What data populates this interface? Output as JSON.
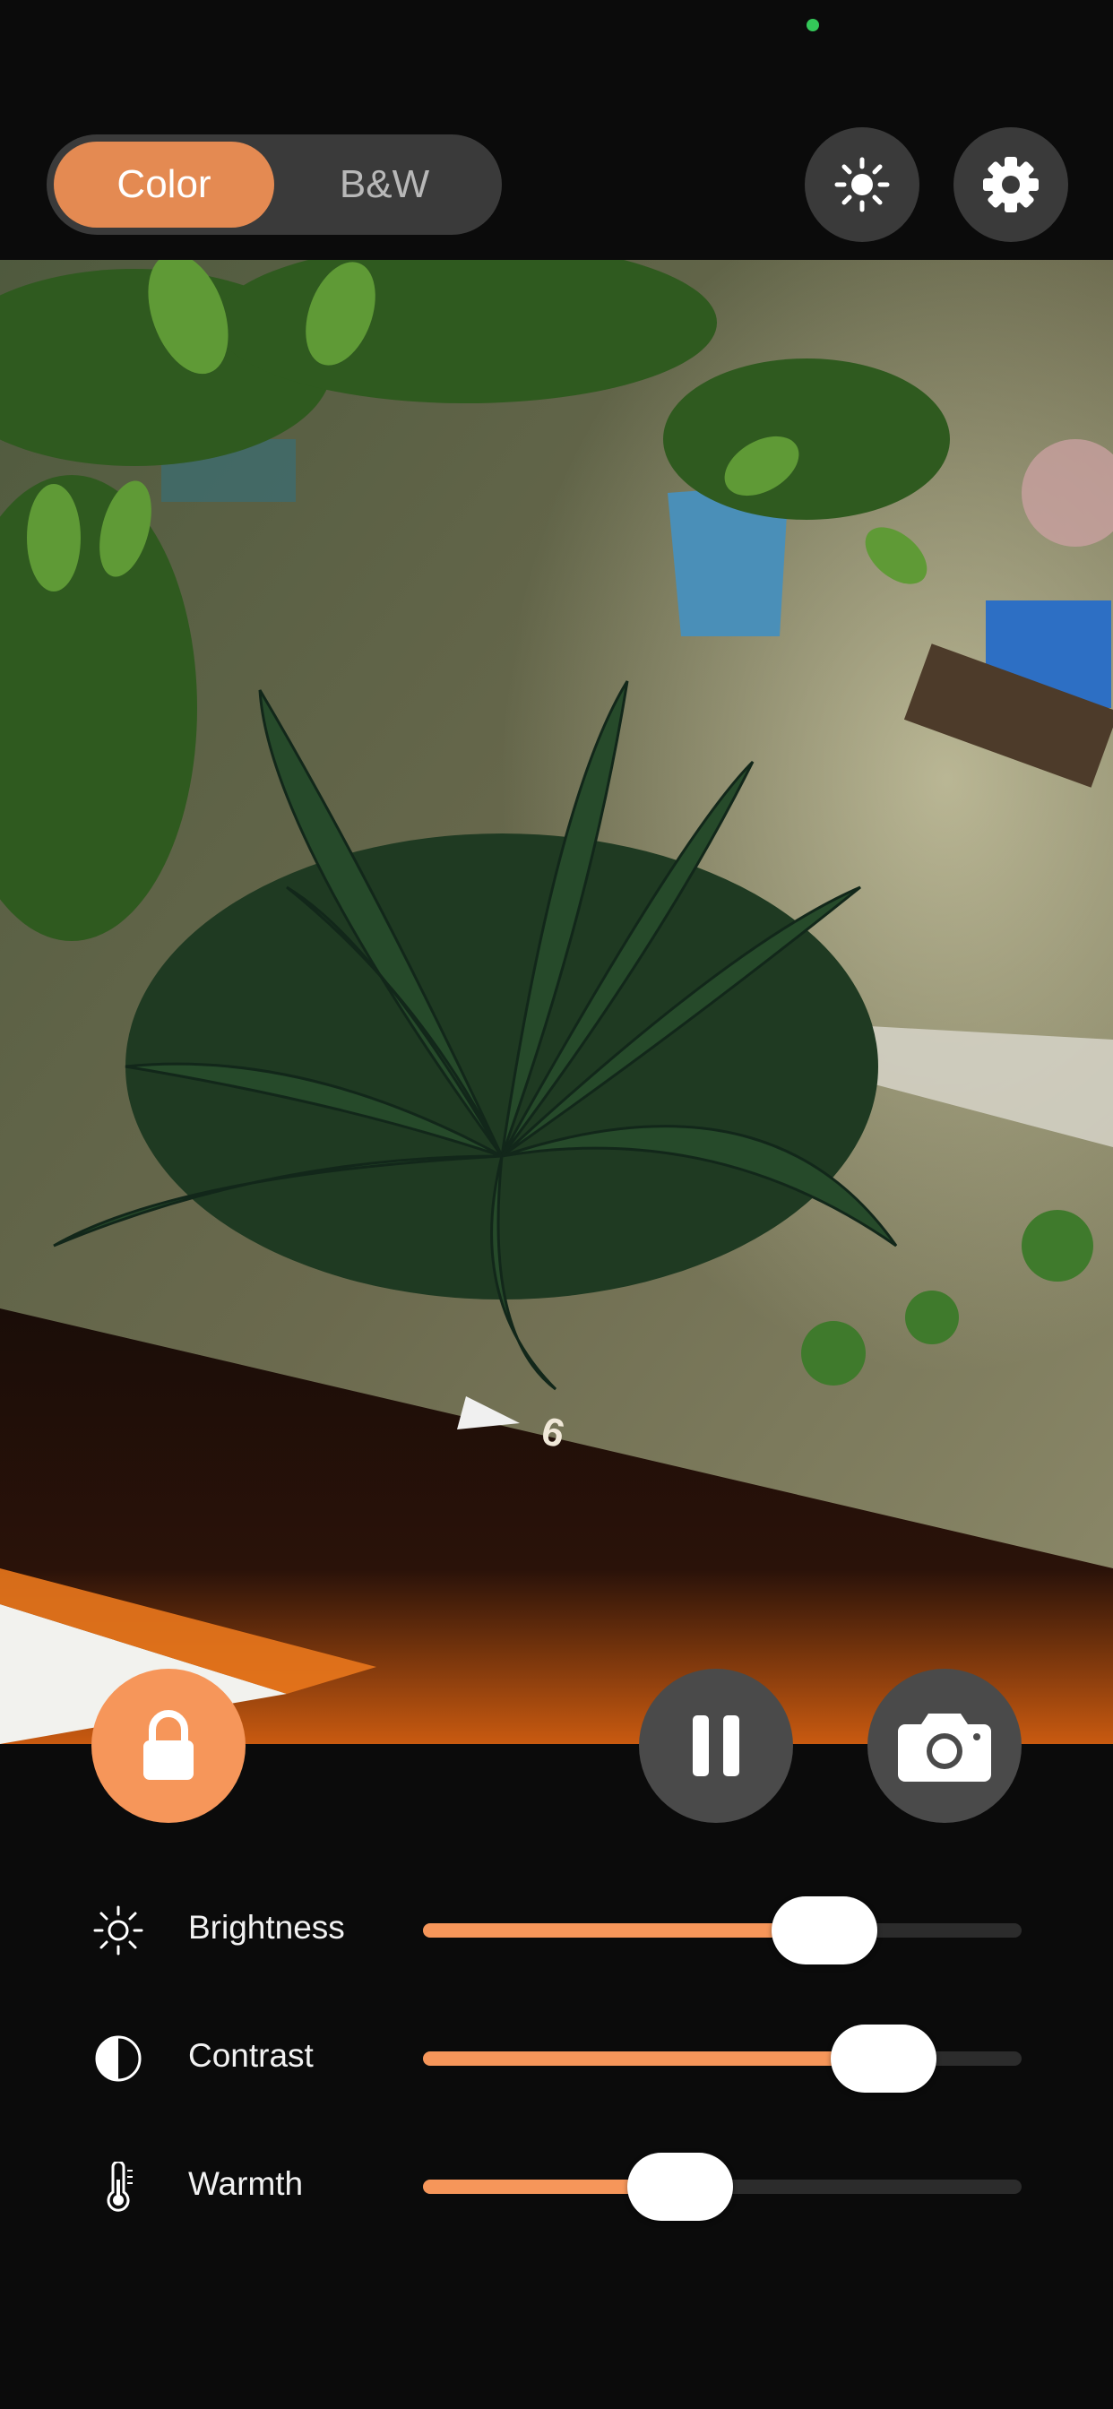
{
  "status": {
    "indicator_color": "#34c759"
  },
  "mode_toggle": {
    "options": [
      "Color",
      "B&W"
    ],
    "selected": "Color"
  },
  "toolbar": {
    "exposure_icon": "sun-icon",
    "settings_icon": "gear-icon"
  },
  "preview": {
    "frame_marker": "6"
  },
  "controls": {
    "lock_icon": "lock-icon",
    "pause_icon": "pause-icon",
    "capture_icon": "camera-icon",
    "lock_color": "#f6965a"
  },
  "sliders": [
    {
      "label": "Brightness",
      "icon": "sun-icon",
      "value": 0.67
    },
    {
      "label": "Contrast",
      "icon": "contrast-icon",
      "value": 0.77
    },
    {
      "label": "Warmth",
      "icon": "thermometer-icon",
      "value": 0.43
    }
  ],
  "accent_color": "#f6965a"
}
